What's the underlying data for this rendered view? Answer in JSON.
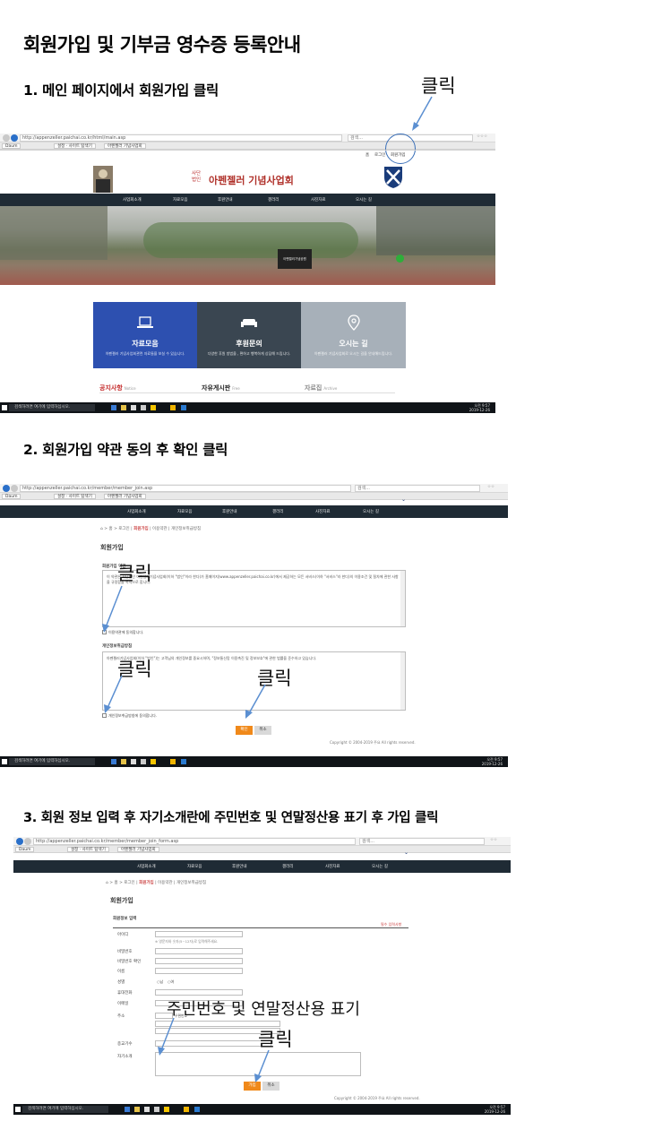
{
  "heading": "회원가입 및 기부금 영수증 등록안내",
  "steps": [
    "1. 메인 페이지에서 회원가입 클릭",
    "2. 회원가입 약관 동의 후 확인 클릭",
    "3. 회원 정보 입력 후 자기소개란에 주민번호 및 연말정산용 표기 후 가입 클릭"
  ],
  "callouts": {
    "click": "클릭",
    "rrn_note": "주민번호 및 연말정산용 표기"
  },
  "browser": {
    "url1": "http://appenzeller.paichai.co.kr/html/main.asp",
    "url2": "http://appenzeller.paichai.co.kr/member/member_join.asp",
    "url3": "http://appenzeller.paichai.co.kr/member/member_join_form.asp",
    "search_placeholder": "검색...",
    "tab_fav1": "Daum",
    "tab_fav2": "설정 · 사이트 탐색기",
    "tab_active": "아펜젤러 기념사업회"
  },
  "taskbar": {
    "search_placeholder": "검색하려면 여기에 입력하십시오.",
    "time": "오전 9:57",
    "date": "2019-12-26"
  },
  "site": {
    "org_small": "사단 법인",
    "org_name": "아펜젤러 기념사업회",
    "top_links": [
      "홈",
      "로그인",
      "회원가입"
    ],
    "menu": [
      "사업회소개",
      "자료모음",
      "후원안내",
      "갤러리",
      "사진자료",
      "오시는 길"
    ],
    "hero_stone": "아펜젤러기념공원",
    "cards": [
      {
        "title": "자료모음",
        "desc": "아펜젤러 기념사업회관련 자료들을 보실 수 있습니다."
      },
      {
        "title": "후원문의",
        "desc": "다양한 후원 방법을 , 편하고 행복하게 상담해 드립니다."
      },
      {
        "title": "오시는 길",
        "desc": "아펜젤러 기념사업회로 오시는 길을 안내해드립니다."
      }
    ],
    "sections": [
      {
        "title": "공지사항",
        "sub": "Notice"
      },
      {
        "title": "자유게시판",
        "sub": "Free"
      },
      {
        "title": "자료집",
        "sub": "Archive"
      }
    ],
    "breadcrumb": [
      "홈",
      "로그인",
      "회원가입",
      "이용약관",
      "개인정보취급방침"
    ],
    "join_title": "회원가입",
    "terms_title": "회원가입 약관",
    "terms_text": "이 약관은 사단법인 아펜젤러기념사업회(이하 \"법인\"이라 한다)가 홈페이지(www.appenzeller.paichai.co.kr)에서 제공하는 모든 서비스(이하 \"서비스\"라 한다)의 이용조건 및 절차에 관한 사항을 규정함을 목적으로 합니다.",
    "terms_agree": "이용약관에 동의합니다.",
    "privacy_title": "개인정보취급방침",
    "privacy_text": "아펜젤러기념사업회(이하 \"법인\")는 고객님의 개인정보를 중요시하며, \"정보통신망 이용촉진 및 정보보호\"에 관한 법률을 준수하고 있습니다.",
    "privacy_agree": "개인정보취급방침에 동의합니다.",
    "ok": "확인",
    "cancel": "취소",
    "join": "가입",
    "copyright": "Copyright © 2004-2019 주요 All rights reserved.",
    "form_title": "회원정보 입력",
    "required_note": "필수 입력사항",
    "form_labels": [
      "아이디",
      "비밀번호",
      "비밀번호 확인",
      "이름",
      "성별",
      "휴대전화",
      "이메일",
      "주소",
      "종교기수",
      "자기소개"
    ],
    "id_hint": "※ 영문자와 숫자(5~12자)로 입력해주세요.",
    "gender": [
      "남",
      "여"
    ],
    "zip_button": "우편번호"
  }
}
